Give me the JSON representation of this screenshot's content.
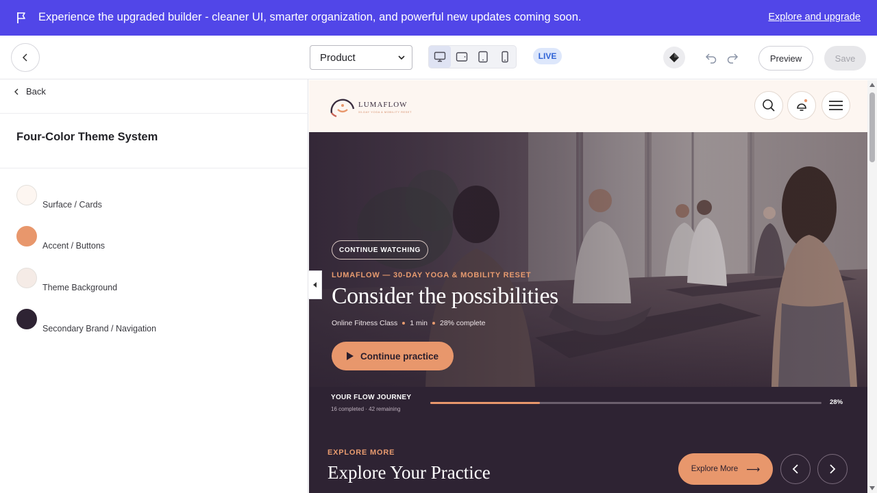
{
  "banner": {
    "message": "Experience the upgraded builder - cleaner UI, smarter organization, and powerful new updates coming soon.",
    "link_label": "Explore and upgrade",
    "background": "#5146e8"
  },
  "toolbar": {
    "page_select_value": "Product",
    "devices": [
      "desktop-icon",
      "tablet-landscape-icon",
      "tablet-icon",
      "mobile-icon"
    ],
    "active_device": "desktop",
    "status_badge": "LIVE",
    "preview_label": "Preview",
    "save_label": "Save"
  },
  "panel": {
    "back_label": "Back",
    "title": "Four-Color Theme System",
    "swatches": [
      {
        "label": "Surface / Cards",
        "color": "#fdf6f1"
      },
      {
        "label": "Accent / Buttons",
        "color": "#e8976c"
      },
      {
        "label": "Theme Background",
        "color": "#f5ebe6"
      },
      {
        "label": "Secondary Brand / Navigation",
        "color": "#2e2333"
      }
    ]
  },
  "site": {
    "logo_name": "LUMAFLOW",
    "logo_tagline": "30-DAY YOGA & MOBILITY RESET",
    "hero": {
      "pill": "CONTINUE WATCHING",
      "eyebrow": "LUMAFLOW — 30-DAY YOGA & MOBILITY RESET",
      "title": "Consider the possibilities",
      "meta_category": "Online Fitness Class",
      "meta_duration": "1 min",
      "meta_progress": "28% complete",
      "cta_label": "Continue practice"
    },
    "journey": {
      "title": "YOUR FLOW JOURNEY",
      "subtitle": "16 completed · 42 remaining",
      "progress": 0.28,
      "progress_label": "28%"
    },
    "explore": {
      "eyebrow": "EXPLORE MORE",
      "title": "Explore Your Practice",
      "button_label": "Explore More"
    }
  },
  "colors": {
    "accent": "#e8976c",
    "navigation": "#2e2333",
    "surface": "#fdf6f1",
    "brand_purple": "#5146e8"
  }
}
